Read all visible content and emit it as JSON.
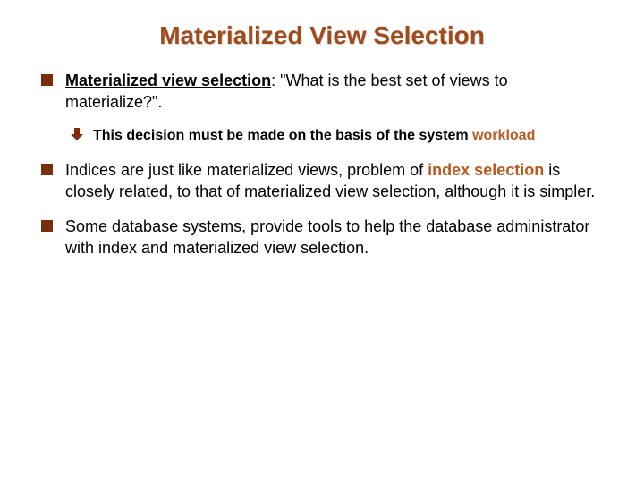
{
  "title": "Materialized View Selection",
  "bullets": [
    {
      "lead_underline": "Materialized view selection",
      "rest": ": \"What is the best set of views to materialize?\".",
      "sub": {
        "pre": "This decision must be made on the basis of the system ",
        "hl": "workload"
      }
    },
    {
      "pre": "Indices are just like materialized views, problem of ",
      "hl": "index selection",
      "post": " is closely related, to that of materialized view selection, although it is simpler."
    },
    {
      "text": "Some database systems, provide tools to help the database administrator with index and materialized view selection."
    }
  ]
}
